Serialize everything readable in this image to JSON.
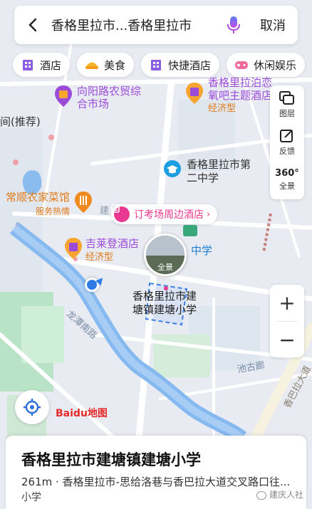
{
  "search": {
    "query": "香格里拉市...香格里拉市",
    "cancel_label": "取消"
  },
  "categories": [
    {
      "label": "酒店",
      "icon": "hotel-icon"
    },
    {
      "label": "美食",
      "icon": "food-icon"
    },
    {
      "label": "快捷酒店",
      "icon": "budget-hotel-icon"
    },
    {
      "label": "休闲娱乐",
      "icon": "entertainment-icon"
    }
  ],
  "tools": {
    "layers_label": "图层",
    "feedback_label": "反馈",
    "panorama_label": "全景",
    "panorama_badge": "360°"
  },
  "zoom": {
    "in_label": "+",
    "out_label": "−"
  },
  "map": {
    "market_name": "向阳路农贸综合市场",
    "hotel_name": "香格里拉泊恋氧吧主题酒店",
    "hotel_tag": "经济型",
    "recommend_label": "间(推荐)",
    "school_name": "香格里拉市第二中学",
    "restaurant_name": "常顺农家菜馆",
    "restaurant_tag": "服务热情",
    "banner_label": "订考场周边酒店",
    "hotel2_name": "吉莱登酒店",
    "hotel2_tag": "经济型",
    "pano_label": "全景",
    "middle_school": "中学",
    "target_name": "香格里拉市建塘镇建塘小学",
    "river_road": "龙潭南路",
    "road_chigu": "池古廊",
    "road_avenue": "香巴拉大道",
    "road_jian": "建"
  },
  "logo": {
    "brand": "Baidu地图"
  },
  "result": {
    "title": "香格里拉市建塘镇建塘小学",
    "address": "261m · 香格里拉市-思给洛巷与香巴拉大道交叉路口往...",
    "category": "小学",
    "watermark": "建庆人社"
  },
  "colors": {
    "accent": "#3478f6",
    "poi_purple": "#9b4bd8",
    "poi_orange": "#e07b19",
    "river": "#7fb4ee",
    "pink": "#e8388f"
  }
}
